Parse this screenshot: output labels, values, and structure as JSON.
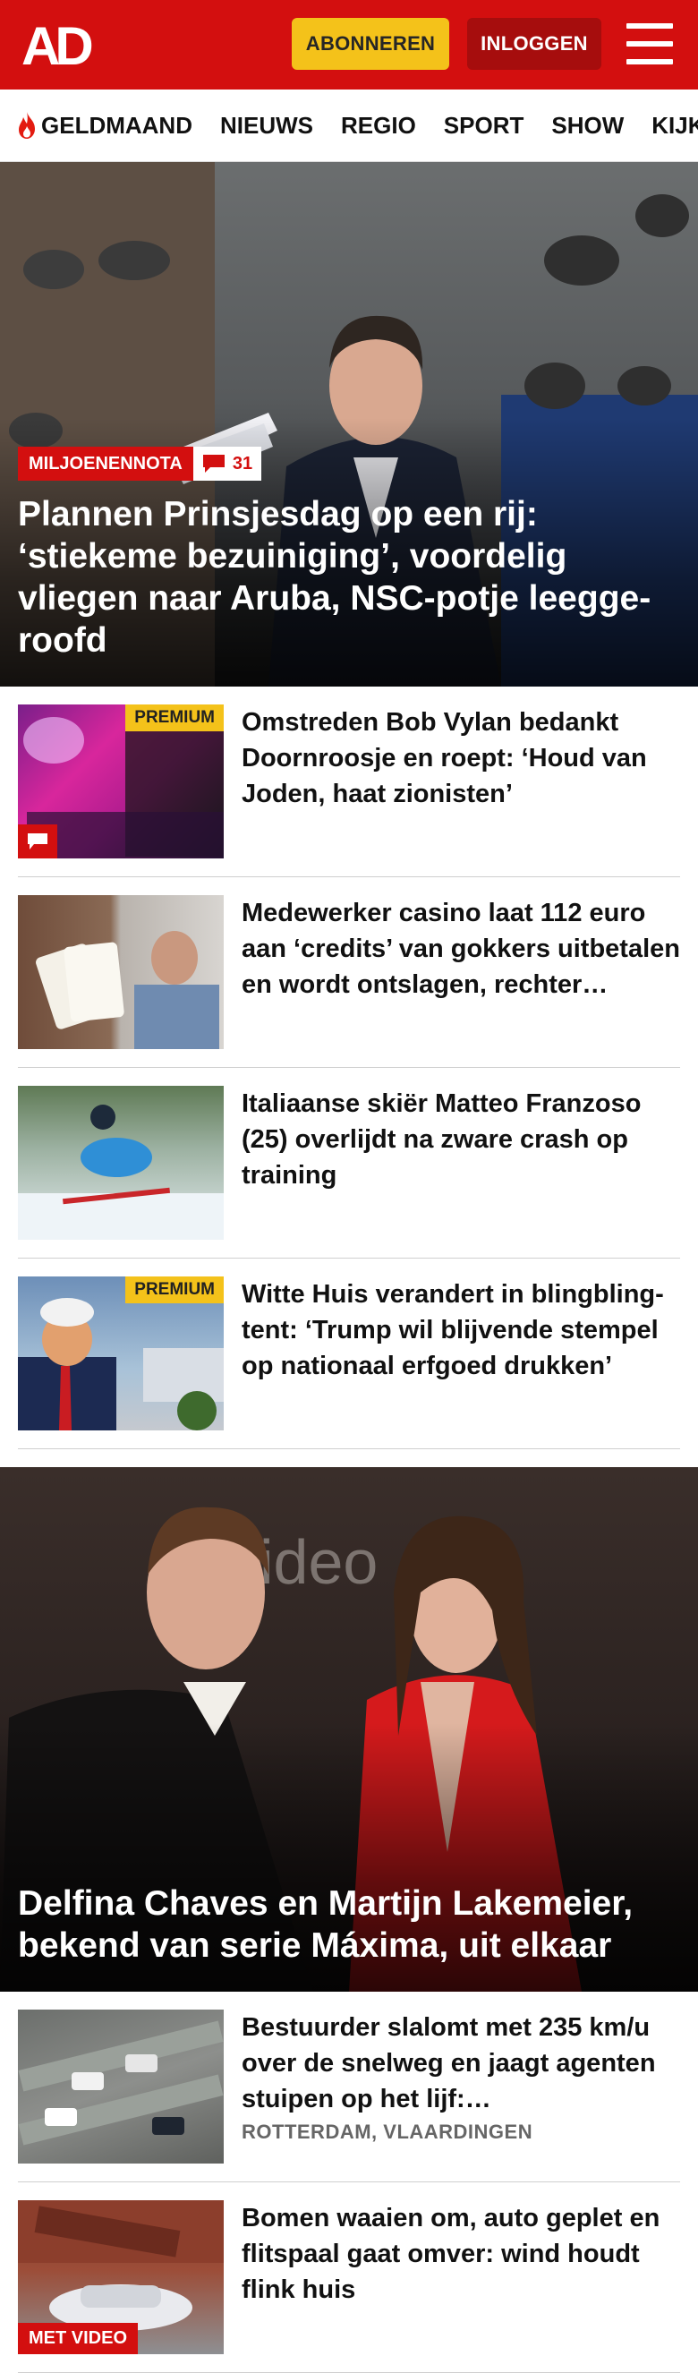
{
  "header": {
    "logo_text": "AD",
    "subscribe_label": "ABONNEREN",
    "login_label": "INLOGGEN",
    "menu_icon": "hamburger-icon",
    "brand_red": "#d30f0f",
    "accent_yellow": "#f4c21a"
  },
  "nav": {
    "items": [
      "GELDMAAND",
      "NIEUWS",
      "REGIO",
      "SPORT",
      "SHOW",
      "KIJK"
    ],
    "flame_icon": "flame-icon"
  },
  "hero1": {
    "tag": "MILJOENENNOTA",
    "comments": "31",
    "title": "Plannen Prinsjesdag op een rij: ‘stiekeme bezuiniging’, voordelig vliegen naar Aruba, NSC-potje leegge­roofd"
  },
  "articles1": [
    {
      "title": "Omstreden Bob Vylan bedankt Doornroosje en roept: ‘Houd van Joden, haat zionisten’",
      "badge": "PREMIUM",
      "meta": ""
    },
    {
      "title": "Medewerker casino laat 112 euro aan ‘credits’ van gokkers uitbetalen en wordt ontslagen, rechter oordeelt anders",
      "badge": "",
      "meta": ""
    },
    {
      "title": "Italiaanse skiër Matteo Franzoso (25) overlijdt na zware crash op training",
      "badge": "",
      "meta": ""
    },
    {
      "title": "Witte Huis verandert in blingbling-tent: ‘Trump wil blijvende stempel op nationaal erfgoed drukken’",
      "badge": "PREMIUM",
      "meta": ""
    }
  ],
  "hero2": {
    "title": "Delfina Chaves en Martijn Lakemeier, bekend van serie Máxima, uit elkaar"
  },
  "articles2": [
    {
      "title": "Bestuurder slalomt met 235 km/u over de snelweg en jaagt agenten stuipen op het lijf: ‘Levensgevaarlijk’",
      "meta": "ROTTERDAM, VLAARDINGEN",
      "badge": ""
    },
    {
      "title": "Bomen waaien om, auto geplet en flitspaal gaat omver: wind houdt flink huis",
      "meta": "",
      "badge": "MET VIDEO"
    }
  ]
}
